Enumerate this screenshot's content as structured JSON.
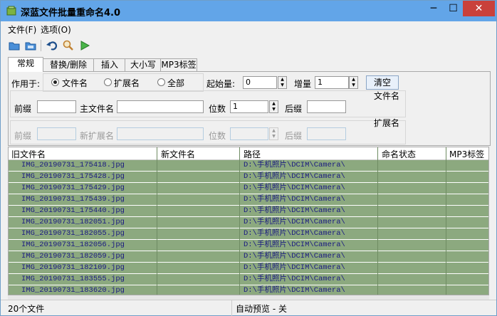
{
  "window": {
    "title": "深蓝文件批量重命名4.0",
    "minimize": "─",
    "maximize": "☐",
    "close": "✕"
  },
  "menu": {
    "file": "文件(F)",
    "options": "选项(O)"
  },
  "tabs": [
    "常规",
    "替换/删除",
    "插入",
    "大小写",
    "MP3标签"
  ],
  "options": {
    "apply_to_label": "作用于:",
    "radio_filename": "文件名",
    "radio_ext": "扩展名",
    "radio_all": "全部",
    "start_label": "起始量:",
    "start_value": "0",
    "increment_label": "增量",
    "increment_value": "1",
    "clear_button": "清空"
  },
  "filename_group": {
    "title": "文件名",
    "prefix_label": "前缀",
    "prefix_value": "",
    "main_label": "主文件名",
    "main_value": "",
    "digits_label": "位数",
    "digits_value": "1",
    "suffix_label": "后缀",
    "suffix_value": ""
  },
  "extension_group": {
    "title": "扩展名",
    "prefix_label": "前缀",
    "new_ext_label": "新扩展名",
    "digits_label": "位数",
    "suffix_label": "后缀"
  },
  "table": {
    "columns": [
      "旧文件名",
      "新文件名",
      "路径",
      "命名状态",
      "MP3标签"
    ],
    "rows": [
      {
        "old": "IMG_20190731_175418.jpg",
        "new": "",
        "path": "D:\\手机照片\\DCIM\\Camera\\",
        "status": ""
      },
      {
        "old": "IMG_20190731_175428.jpg",
        "new": "",
        "path": "D:\\手机照片\\DCIM\\Camera\\",
        "status": ""
      },
      {
        "old": "IMG_20190731_175429.jpg",
        "new": "",
        "path": "D:\\手机照片\\DCIM\\Camera\\",
        "status": ""
      },
      {
        "old": "IMG_20190731_175439.jpg",
        "new": "",
        "path": "D:\\手机照片\\DCIM\\Camera\\",
        "status": ""
      },
      {
        "old": "IMG_20190731_175440.jpg",
        "new": "",
        "path": "D:\\手机照片\\DCIM\\Camera\\",
        "status": ""
      },
      {
        "old": "IMG_20190731_182051.jpg",
        "new": "",
        "path": "D:\\手机照片\\DCIM\\Camera\\",
        "status": ""
      },
      {
        "old": "IMG_20190731_182055.jpg",
        "new": "",
        "path": "D:\\手机照片\\DCIM\\Camera\\",
        "status": ""
      },
      {
        "old": "IMG_20190731_182056.jpg",
        "new": "",
        "path": "D:\\手机照片\\DCIM\\Camera\\",
        "status": ""
      },
      {
        "old": "IMG_20190731_182059.jpg",
        "new": "",
        "path": "D:\\手机照片\\DCIM\\Camera\\",
        "status": ""
      },
      {
        "old": "IMG_20190731_182109.jpg",
        "new": "",
        "path": "D:\\手机照片\\DCIM\\Camera\\",
        "status": ""
      },
      {
        "old": "IMG_20190731_183555.jpg",
        "new": "",
        "path": "D:\\手机照片\\DCIM\\Camera\\",
        "status": ""
      },
      {
        "old": "IMG_20190731_183620.jpg",
        "new": "",
        "path": "D:\\手机照片\\DCIM\\Camera\\",
        "status": ""
      }
    ]
  },
  "status": {
    "count": "20个文件",
    "preview": "自动预览 - 关"
  },
  "colors": {
    "titlebar": "#62a5e8",
    "close": "#c9413b",
    "row_bg": "#8ca97f",
    "row_text": "#1a1a80"
  }
}
